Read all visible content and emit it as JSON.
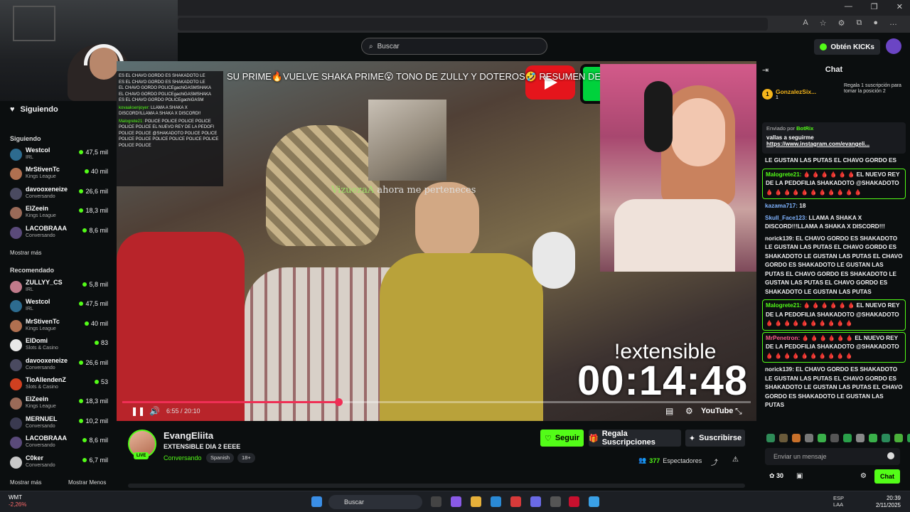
{
  "header": {
    "search_placeholder": "Buscar",
    "obten_label": "Obtén KICKs"
  },
  "sidebar": {
    "following_header": "Siguiendo",
    "section_following": "Siguiendo",
    "following": [
      {
        "name": "Westcol",
        "category": "IRL",
        "viewers": "47,5 mil",
        "color": "#2d6b8f"
      },
      {
        "name": "MrStivenTc",
        "category": "Kings League",
        "viewers": "40 mil",
        "color": "#b07050"
      },
      {
        "name": "davooxeneize",
        "category": "Conversando",
        "viewers": "26,6 mil",
        "color": "#4a4a60"
      },
      {
        "name": "ElZeein",
        "category": "Kings League",
        "viewers": "18,3 mil",
        "color": "#9a6a58"
      },
      {
        "name": "LACOBRAAA",
        "category": "Conversando",
        "viewers": "8,6 mil",
        "color": "#5a4a7a"
      }
    ],
    "show_more": "Mostrar más",
    "section_recommended": "Recomendado",
    "recommended": [
      {
        "name": "ZULLYY_CS",
        "category": "IRL",
        "viewers": "5,8 mil",
        "color": "#c07a8a"
      },
      {
        "name": "Westcol",
        "category": "IRL",
        "viewers": "47,5 mil",
        "color": "#2d6b8f"
      },
      {
        "name": "MrStivenTc",
        "category": "Kings League",
        "viewers": "40 mil",
        "color": "#b07050"
      },
      {
        "name": "ElDomi",
        "category": "Slots & Casino",
        "viewers": "83",
        "color": "#e8e8e8"
      },
      {
        "name": "davooxeneize",
        "category": "Conversando",
        "viewers": "26,6 mil",
        "color": "#4a4a60"
      },
      {
        "name": "TioAllendenZ",
        "category": "Slots & Casino",
        "viewers": "53",
        "color": "#d04020"
      },
      {
        "name": "ElZeein",
        "category": "Kings League",
        "viewers": "18,3 mil",
        "color": "#9a6a58"
      },
      {
        "name": "MERNUEL",
        "category": "Conversando",
        "viewers": "10,2 mil",
        "color": "#3a3a50"
      },
      {
        "name": "LACOBRAAA",
        "category": "Conversando",
        "viewers": "8,6 mil",
        "color": "#5a4a7a"
      },
      {
        "name": "C0ker",
        "category": "Conversando",
        "viewers": "6,7 mil",
        "color": "#c8c8c8"
      }
    ],
    "show_more_2": "Mostrar más",
    "show_less": "Mostrar Menos"
  },
  "overlay_chat": {
    "lines": [
      "ES EL CHAVO GORDO ES SHAKADOTO LE",
      "ES EL CHAVO GORDO ES SHAKADOTO LE",
      "EL CHAVO GORDO POLICEgachiGASMSHAKA",
      "EL CHAVO GORDO POLICEgachiGASMSHAKA",
      "ES EL CHAVO GORDO POLICEgachiGASM"
    ],
    "user1": "kovaaksenjoyer:",
    "msg1": "LLAMA A SHAKA X DISCORD!!LLAMA A SHAKA X DISCORD!!",
    "user2": "Malogrete21:",
    "msg2": "POLICE POLICE POLICE POLICE POLICE POLICE EL NUEVO REY DE LA PEDOFI POLICE POLICE @SHAKADOTO POLICE POLICE POLICE POLICE POLICE POLICE POLICE POLICE POLICE POLICE"
  },
  "video": {
    "title_overlay": "SU PRIME🔥VUELVE SHAKA PRIME😮 TONO DE ZULLY Y DOTEROS🤣 RESUMEN DE KICK DO",
    "overlay_user": "VizuezaA",
    "overlay_text": " ahora me perteneces",
    "extensible": "!extensible",
    "timer": "00:14:48",
    "time": "6:55 / 20:10",
    "progress": 0.344,
    "youtube": "YouTube"
  },
  "stream": {
    "name": "EvangEliita",
    "title": "EXTENSIBLE DIA 2 EEEE",
    "category": "Conversando",
    "tags": [
      "Spanish",
      "18+"
    ],
    "live": "LIVE",
    "follow": "Seguir",
    "gift": "Regala Suscripciones",
    "subscribe": "Suscribirse",
    "viewers_count": "377",
    "viewers_label": "Espectadores"
  },
  "chat": {
    "title": "Chat",
    "top_gifter": "GonzalezSix...",
    "top_gifter_count": "1",
    "gift_text": "Regala 1 suscripción para tomar la posición 2",
    "pinned_by": "Enviado por",
    "pinned_bot": "BotRix",
    "pinned_msg": "vallas a seguirme",
    "pinned_link": "https://www.instagram.com/evangeli...",
    "messages": [
      {
        "user": "",
        "text": "LE GUSTAN LAS PUTAS EL CHAVO GORDO ES",
        "color": "#efeff1",
        "hl": false
      },
      {
        "user": "Malogrete21:",
        "text": "🩸 🩸 🩸 🩸 🩸 🩸 EL NUEVO REY DE LA PEDOFILIA SHAKADOTO @SHAKADOTO 🩸 🩸 🩸 🩸 🩸 🩸 🩸 🩸 🩸 🩸 🩸",
        "color": "#53fc18",
        "hl": true
      },
      {
        "user": "kazama717:",
        "text": "18",
        "color": "#7fb3ff",
        "hl": false
      },
      {
        "user": "Skull_Face123:",
        "text": "LLAMA A SHAKA X DISCORD!!!LLAMA A SHAKA X DISCORD!!!",
        "color": "#7fb3ff",
        "hl": false
      },
      {
        "user": "norick139:",
        "text": "EL CHAVO GORDO ES SHAKADOTO LE GUSTAN LAS PUTAS EL CHAVO GORDO ES SHAKADOTO LE GUSTAN LAS PUTAS EL CHAVO GORDO ES SHAKADOTO LE GUSTAN LAS PUTAS EL CHAVO GORDO ES SHAKADOTO LE GUSTAN LAS PUTAS EL CHAVO GORDO ES SHAKADOTO LE GUSTAN LAS PUTAS",
        "color": "#efeff1",
        "hl": false
      },
      {
        "user": "Malogrete21:",
        "text": "🩸 🩸 🩸 🩸 🩸 🩸 EL NUEVO REY DE LA PEDOFILIA SHAKADOTO @SHAKADOTO 🩸 🩸 🩸 🩸 🩸 🩸 🩸 🩸 🩸 🩸",
        "color": "#53fc18",
        "hl": true
      },
      {
        "user": "MrPenetron:",
        "text": "🩸 🩸 🩸 🩸 🩸 🩸 EL NUEVO REY DE LA PEDOFILIA SHAKADOTO @SHAKADOTO 🩸 🩸 🩸 🩸 🩸 🩸 🩸 🩸 🩸 🩸",
        "color": "#ff5c8a",
        "hl": true
      },
      {
        "user": "norick139:",
        "text": "EL CHAVO GORDO ES SHAKADOTO LE GUSTAN LAS PUTAS EL CHAVO GORDO ES SHAKADOTO LE GUSTAN LAS PUTAS EL CHAVO GORDO ES SHAKADOTO LE GUSTAN LAS PUTAS",
        "color": "#efeff1",
        "hl": false
      }
    ],
    "input_placeholder": "Enviar un mensaje",
    "points": "30",
    "send": "Chat"
  },
  "taskbar": {
    "stock_name": "WMT",
    "stock_change": "-2,26%",
    "search": "Buscar",
    "lang1": "ESP",
    "lang2": "LAA",
    "time": "20:39",
    "date": "2/11/2025"
  },
  "colors": {
    "kick_green": "#53fc18",
    "background": "#0b0e0f",
    "progress": "#ef2f55"
  }
}
